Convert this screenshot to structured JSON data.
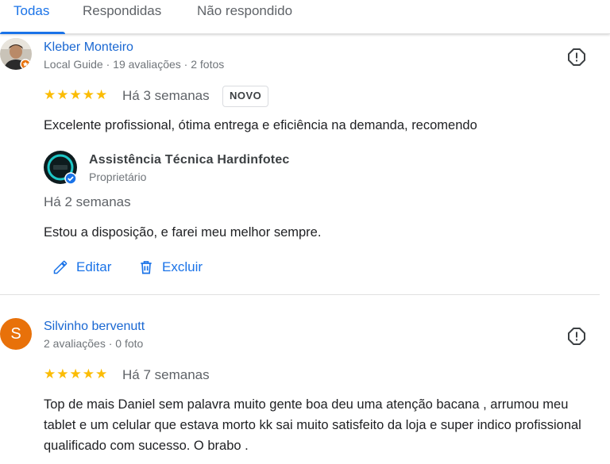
{
  "tabs": [
    {
      "label": "Todas"
    },
    {
      "label": "Respondidas"
    },
    {
      "label": "Não respondido"
    }
  ],
  "reviews": [
    {
      "name": "Kleber Monteiro",
      "meta": "Local Guide · 19 avaliações · 2 fotos",
      "stars": "★★★★★",
      "rating": 5,
      "date": "Há 3 semanas",
      "badge": "NOVO",
      "text": "Excelente profissional, ótima entrega e eficiência na demanda, recomendo",
      "reply": {
        "owner_name": "Assistência Técnica Hardinfotec",
        "owner_role": "Proprietário",
        "date": "Há 2 semanas",
        "text": "Estou a disposição, e farei meu melhor sempre."
      },
      "actions": {
        "edit_label": "Editar",
        "delete_label": "Excluir"
      }
    },
    {
      "name": "Silvinho bervenutt",
      "avatar_letter": "S",
      "meta": "2 avaliações · 0 foto",
      "stars": "★★★★★",
      "rating": 5,
      "date": "Há 7 semanas",
      "text": "Top de mais Daniel sem palavra muito gente boa deu uma atenção bacana , arrumou meu tablet e um celular que estava morto kk sai muito satisfeito da loja e super indico profissional qualificado com sucesso. O brabo ."
    }
  ],
  "colors": {
    "accent": "#1a73e8",
    "star": "#fbbc04",
    "avatar_orange": "#e8710a"
  }
}
